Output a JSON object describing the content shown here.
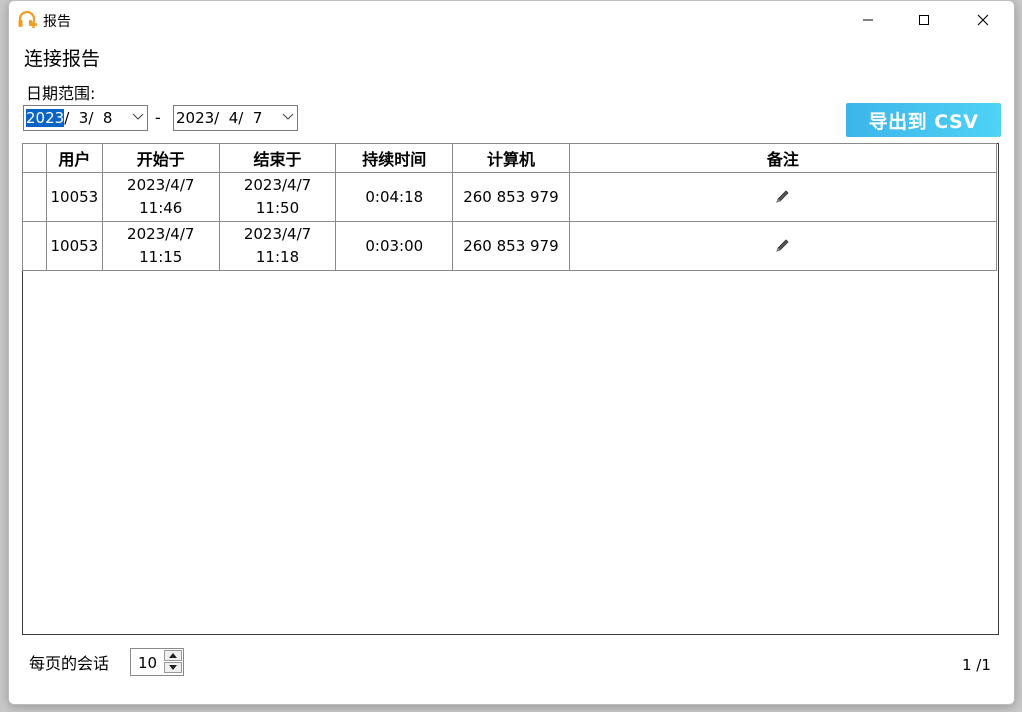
{
  "window": {
    "title": "报告",
    "icon": "headset-plus-icon",
    "accent_color": "#f29b1e"
  },
  "page": {
    "title": "连接报告",
    "range_label": "日期范围:"
  },
  "date_from": {
    "selected": "2023",
    "rest": "/  3/  8"
  },
  "date_separator": "-",
  "date_to": {
    "value": "2023/  4/  7"
  },
  "export_button": {
    "label": "导出到 CSV",
    "color": "#3cb5ea"
  },
  "table": {
    "columns": [
      "",
      "用户",
      "开始于",
      "结束于",
      "持续时间",
      "计算机",
      "备注"
    ],
    "rows": [
      {
        "user": "10053",
        "start_date": "2023/4/7",
        "start_time": "11:46",
        "end_date": "2023/4/7",
        "end_time": "11:50",
        "duration": "0:04:18",
        "computer": "260 853 979",
        "note_icon": "pencil-icon"
      },
      {
        "user": "10053",
        "start_date": "2023/4/7",
        "start_time": "11:15",
        "end_date": "2023/4/7",
        "end_time": "11:18",
        "duration": "0:03:00",
        "computer": "260 853 979",
        "note_icon": "pencil-icon"
      }
    ]
  },
  "footer": {
    "per_page_label": "每页的会话",
    "per_page_value": "10",
    "page_indicator": "1 /1"
  }
}
